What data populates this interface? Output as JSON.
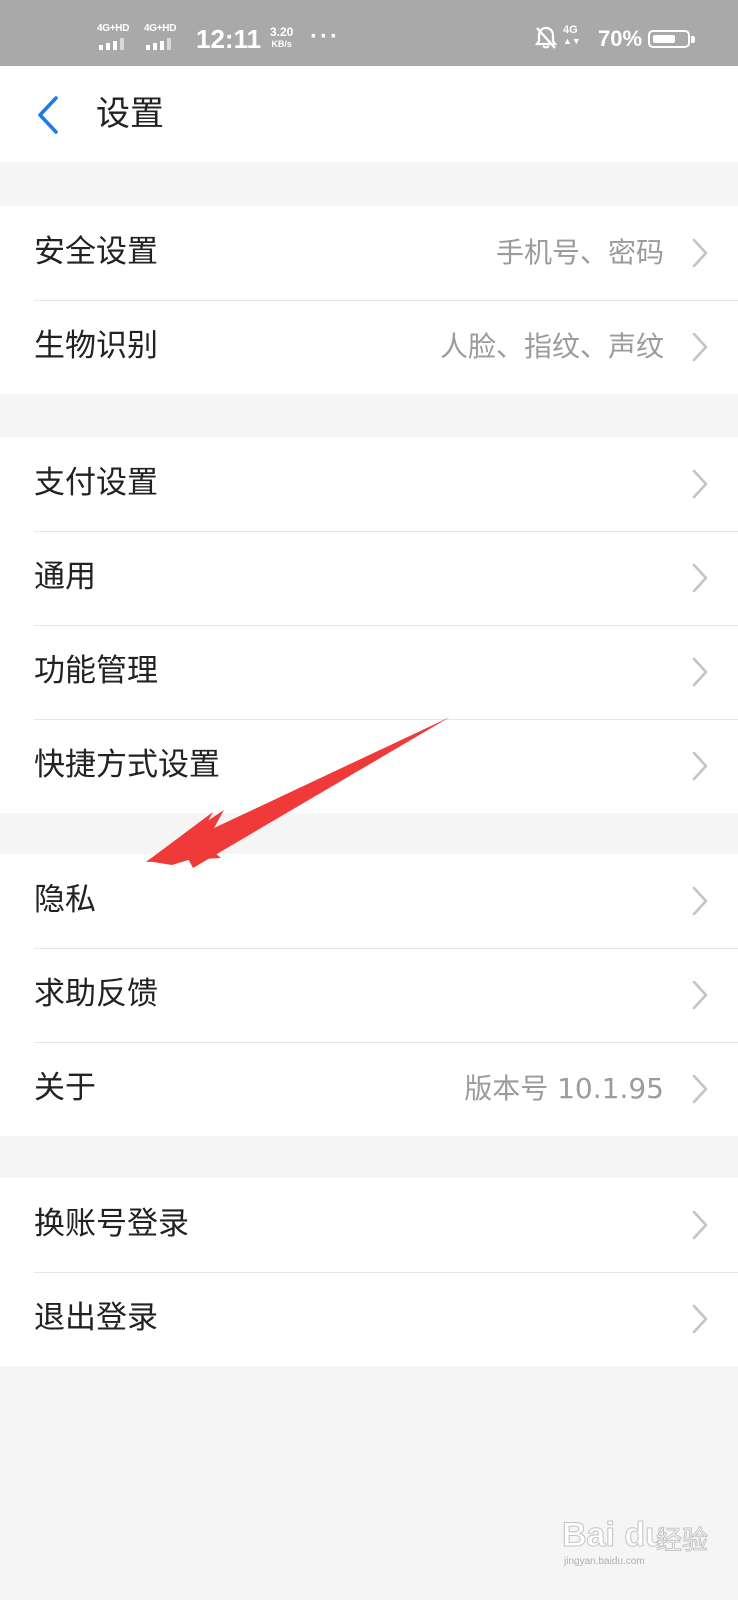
{
  "status_bar": {
    "sim1": "4G+HD",
    "sim2": "4G+HD",
    "time": "12:11",
    "speed_value": "3.20",
    "speed_unit": "KB/s",
    "more": "···",
    "network": "4G",
    "battery_text": "70%",
    "battery_level": 0.7
  },
  "header": {
    "title": "设置",
    "back_icon": "chevron-left-icon"
  },
  "groups": [
    {
      "rows": [
        {
          "label": "安全设置",
          "value": "手机号、密码"
        },
        {
          "label": "生物识别",
          "value": "人脸、指纹、声纹"
        }
      ]
    },
    {
      "rows": [
        {
          "label": "支付设置",
          "value": ""
        },
        {
          "label": "通用",
          "value": ""
        },
        {
          "label": "功能管理",
          "value": ""
        },
        {
          "label": "快捷方式设置",
          "value": ""
        }
      ]
    },
    {
      "rows": [
        {
          "label": "隐私",
          "value": ""
        },
        {
          "label": "求助反馈",
          "value": ""
        },
        {
          "label": "关于",
          "value": "版本号 10.1.95"
        }
      ]
    },
    {
      "rows": [
        {
          "label": "换账号登录",
          "value": ""
        },
        {
          "label": "退出登录",
          "value": ""
        }
      ]
    }
  ],
  "colors": {
    "accent_blue": "#1e7ce8",
    "annotation_arrow": "#f03a3a",
    "statusbar_bg": "#a9a9a9"
  },
  "watermark": {
    "brand": "Bai du",
    "cn": "经验",
    "url": "jingyan.baidu.com"
  }
}
